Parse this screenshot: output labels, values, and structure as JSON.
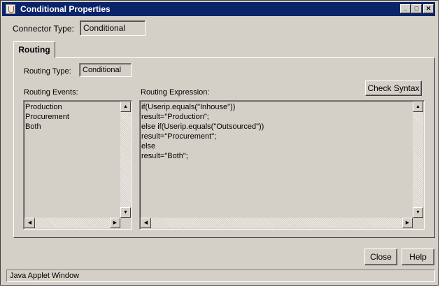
{
  "window": {
    "title": "Conditional Properties"
  },
  "connector_type": {
    "label": "Connector Type:",
    "value": "Conditional"
  },
  "tabs": [
    {
      "label": "Routing"
    }
  ],
  "routing_type": {
    "label": "Routing Type:",
    "value": "Conditional"
  },
  "routing_events": {
    "label": "Routing Events:",
    "items": [
      "Production",
      "Procurement",
      "Both"
    ]
  },
  "routing_expression": {
    "label": "Routing Expression:",
    "lines": [
      "if(Userip.equals(\"Inhouse\"))",
      "result=\"Production\";",
      "else if(Userip.equals(\"Outsourced\"))",
      "result=\"Procurement\";",
      "else",
      "result=\"Both\";"
    ]
  },
  "buttons": {
    "check_syntax": "Check Syntax",
    "close": "Close",
    "help": "Help"
  },
  "status_bar": {
    "text": "Java Applet Window"
  },
  "icons": {
    "app": "java-cup-icon",
    "minimize": "minimize-icon",
    "maximize": "maximize-icon",
    "close": "close-icon"
  },
  "colors": {
    "titlebar": "#0a246a",
    "face": "#d4d0c8"
  }
}
